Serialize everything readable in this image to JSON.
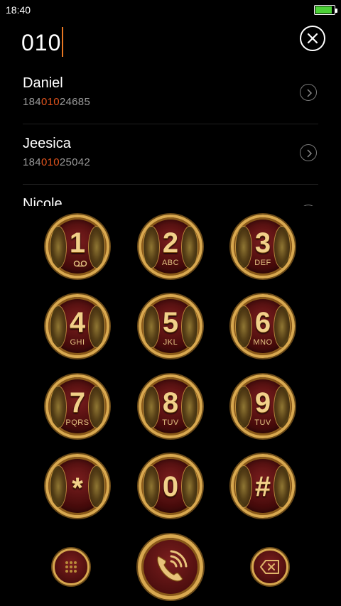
{
  "status_bar": {
    "time": "18:40",
    "battery_level_pct": 90,
    "battery_color": "#4cd137"
  },
  "search": {
    "query": "010"
  },
  "contacts": [
    {
      "name": "Daniel",
      "number_prefix": "184",
      "number_match": "010",
      "number_suffix": "24685"
    },
    {
      "name": "Jeesica",
      "number_prefix": "184",
      "number_match": "010",
      "number_suffix": "25042"
    },
    {
      "name": "Nicole"
    }
  ],
  "keypad": {
    "keys": [
      {
        "digit": "1",
        "letters": "",
        "icon": "voicemail-icon"
      },
      {
        "digit": "2",
        "letters": "ABC"
      },
      {
        "digit": "3",
        "letters": "DEF"
      },
      {
        "digit": "4",
        "letters": "GHI"
      },
      {
        "digit": "5",
        "letters": "JKL"
      },
      {
        "digit": "6",
        "letters": "MNO"
      },
      {
        "digit": "7",
        "letters": "PQRS"
      },
      {
        "digit": "8",
        "letters": "TUV"
      },
      {
        "digit": "9",
        "letters": "TUV"
      },
      {
        "digit": "*",
        "letters": ""
      },
      {
        "digit": "0",
        "letters": ""
      },
      {
        "digit": "#",
        "letters": ""
      }
    ],
    "bottom": {
      "left_icon": "dialpad-grid-icon",
      "center_icon": "phone-call-icon",
      "right_icon": "backspace-icon"
    }
  },
  "colors": {
    "highlight": "#e2541d",
    "caret": "#e87722",
    "gold": "#d8a84f",
    "key_red": "#7a1e1e"
  }
}
